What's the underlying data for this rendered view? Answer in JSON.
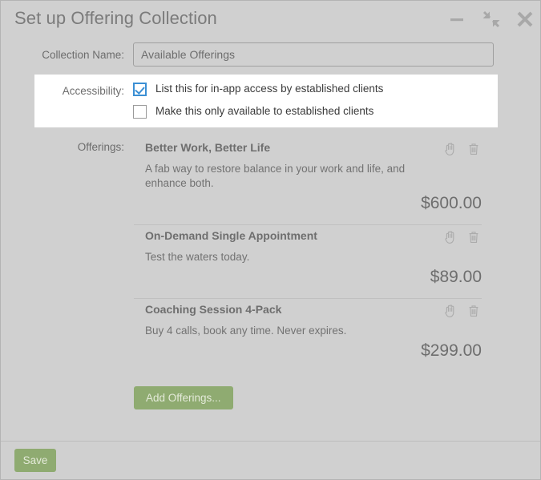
{
  "window": {
    "title": "Set up Offering Collection",
    "controls": [
      {
        "name": "minimize-button",
        "icon": "minimize-icon",
        "label": "Minimize"
      },
      {
        "name": "restore-button",
        "icon": "restore-down-icon",
        "label": "Restore Down"
      },
      {
        "name": "close-button",
        "icon": "close-icon",
        "label": "Close"
      }
    ]
  },
  "form": {
    "collection_name": {
      "label": "Collection Name:",
      "value": "Available Offerings",
      "placeholder": ""
    },
    "accessibility": {
      "label": "Accessibility:",
      "options": [
        {
          "label": "List this for in-app access by established clients",
          "checked": true
        },
        {
          "label": "Make this only available to established clients",
          "checked": false
        }
      ]
    },
    "offerings": {
      "label": "Offerings:",
      "items": [
        {
          "title": "Better Work, Better Life",
          "description": "A fab way to restore balance in your work and life, and enhance both.",
          "price": "$600.00",
          "drag_icon": "hand-icon",
          "delete_icon": "trash-icon"
        },
        {
          "title": "On-Demand Single Appointment",
          "description": "Test the waters today.",
          "price": "$89.00",
          "drag_icon": "hand-icon",
          "delete_icon": "trash-icon"
        },
        {
          "title": "Coaching Session 4-Pack",
          "description": "Buy 4 calls, book any time. Never expires.",
          "price": "$299.00",
          "drag_icon": "hand-icon",
          "delete_icon": "trash-icon"
        }
      ],
      "add_button_label": "Add Offerings..."
    }
  },
  "footer": {
    "save_label": "Save"
  },
  "colors": {
    "dialog_background": "#d0d0d0",
    "highlight_panel": "#ffffff",
    "accent_green": "#8fab71",
    "checkbox_blue": "#3b8fd4",
    "text_gray": "#6d6d6d"
  }
}
